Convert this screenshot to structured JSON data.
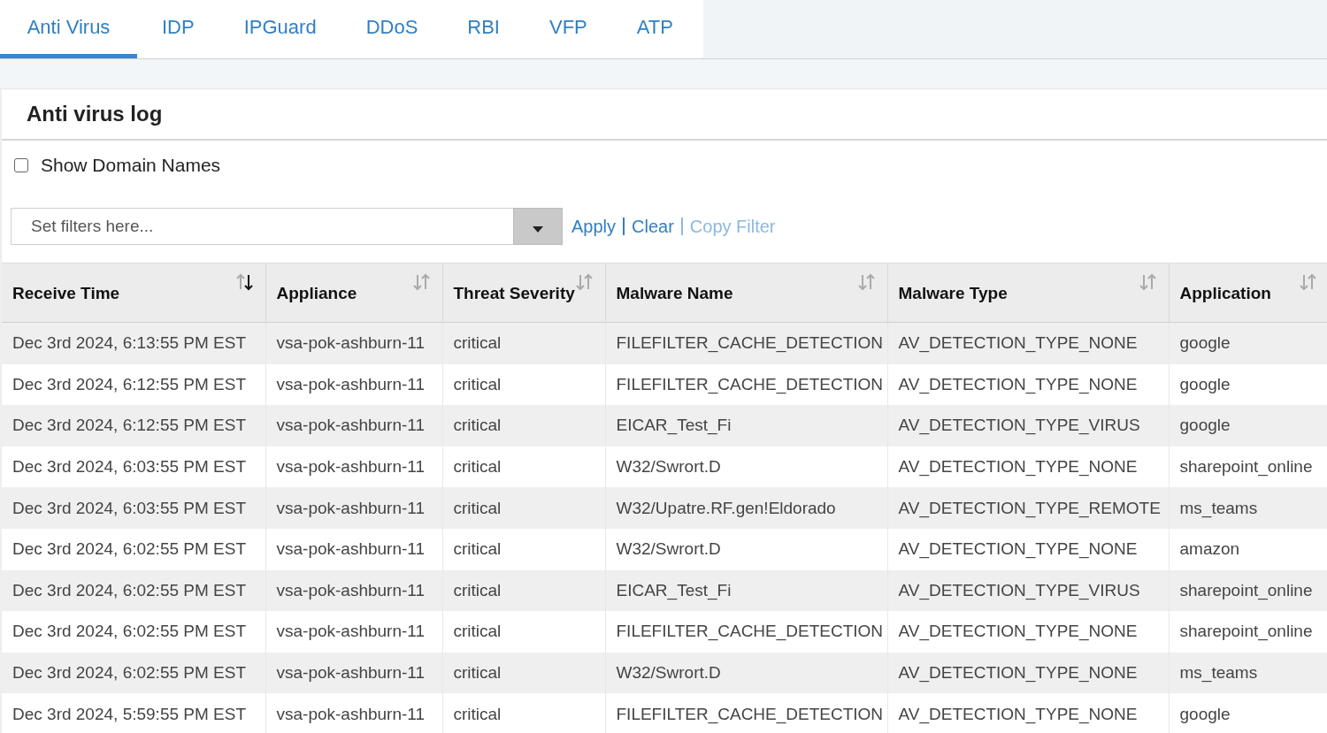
{
  "tabs": [
    {
      "label": "Anti Virus",
      "selected": true
    },
    {
      "label": "IDP",
      "selected": false
    },
    {
      "label": "IPGuard",
      "selected": false
    },
    {
      "label": "DDoS",
      "selected": false
    },
    {
      "label": "RBI",
      "selected": false
    },
    {
      "label": "VFP",
      "selected": false
    },
    {
      "label": "ATP",
      "selected": false
    }
  ],
  "panel": {
    "title": "Anti virus log"
  },
  "show_domain_names": {
    "label": "Show Domain Names",
    "checked": false
  },
  "filter": {
    "placeholder": "Set filters here...",
    "actions": [
      {
        "label": "Apply",
        "disabled": false
      },
      {
        "label": "Clear",
        "disabled": false
      },
      {
        "label": "Copy Filter",
        "disabled": true
      }
    ]
  },
  "table": {
    "columns": [
      {
        "label": "Receive Time",
        "sort_active": true
      },
      {
        "label": "Appliance",
        "sort_active": false
      },
      {
        "label": "Threat Severity",
        "sort_active": false
      },
      {
        "label": "Malware Name",
        "sort_active": false
      },
      {
        "label": "Malware Type",
        "sort_active": false
      },
      {
        "label": "Application",
        "sort_active": false
      }
    ],
    "rows": [
      [
        "Dec 3rd 2024, 6:13:55 PM EST",
        "vsa-pok-ashburn-11",
        "critical",
        "FILEFILTER_CACHE_DETECTION",
        "AV_DETECTION_TYPE_NONE",
        "google"
      ],
      [
        "Dec 3rd 2024, 6:12:55 PM EST",
        "vsa-pok-ashburn-11",
        "critical",
        "FILEFILTER_CACHE_DETECTION",
        "AV_DETECTION_TYPE_NONE",
        "google"
      ],
      [
        "Dec 3rd 2024, 6:12:55 PM EST",
        "vsa-pok-ashburn-11",
        "critical",
        "EICAR_Test_Fi",
        "AV_DETECTION_TYPE_VIRUS",
        "google"
      ],
      [
        "Dec 3rd 2024, 6:03:55 PM EST",
        "vsa-pok-ashburn-11",
        "critical",
        "W32/Swrort.D",
        "AV_DETECTION_TYPE_NONE",
        "sharepoint_online"
      ],
      [
        "Dec 3rd 2024, 6:03:55 PM EST",
        "vsa-pok-ashburn-11",
        "critical",
        "W32/Upatre.RF.gen!Eldorado",
        "AV_DETECTION_TYPE_REMOTE",
        "ms_teams"
      ],
      [
        "Dec 3rd 2024, 6:02:55 PM EST",
        "vsa-pok-ashburn-11",
        "critical",
        "W32/Swrort.D",
        "AV_DETECTION_TYPE_NONE",
        "amazon"
      ],
      [
        "Dec 3rd 2024, 6:02:55 PM EST",
        "vsa-pok-ashburn-11",
        "critical",
        "EICAR_Test_Fi",
        "AV_DETECTION_TYPE_VIRUS",
        "sharepoint_online"
      ],
      [
        "Dec 3rd 2024, 6:02:55 PM EST",
        "vsa-pok-ashburn-11",
        "critical",
        "FILEFILTER_CACHE_DETECTION",
        "AV_DETECTION_TYPE_NONE",
        "sharepoint_online"
      ],
      [
        "Dec 3rd 2024, 6:02:55 PM EST",
        "vsa-pok-ashburn-11",
        "critical",
        "W32/Swrort.D",
        "AV_DETECTION_TYPE_NONE",
        "ms_teams"
      ],
      [
        "Dec 3rd 2024, 5:59:55 PM EST",
        "vsa-pok-ashburn-11",
        "critical",
        "FILEFILTER_CACHE_DETECTION",
        "AV_DETECTION_TYPE_NONE",
        "google"
      ]
    ]
  }
}
